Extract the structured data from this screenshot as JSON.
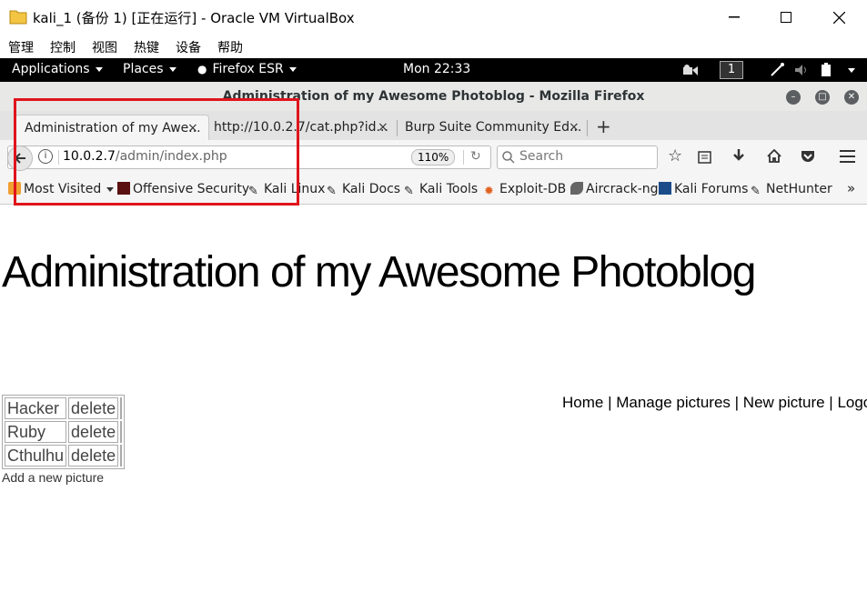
{
  "vbox": {
    "title": "kali_1 (备份 1) [正在运行] - Oracle VM VirtualBox",
    "menu": [
      "管理",
      "控制",
      "视图",
      "热键",
      "设备",
      "帮助"
    ]
  },
  "gnome": {
    "applications": "Applications",
    "places": "Places",
    "firefox": "Firefox ESR",
    "clock": "Mon 22:33",
    "workspace": "1"
  },
  "firefox": {
    "window_title": "Administration of my Awesome Photoblog - Mozilla Firefox",
    "tabs": [
      {
        "label": "Administration of my Awe..."
      },
      {
        "label": "http://10.0.2.7/cat.php?id..."
      },
      {
        "label": "Burp Suite Community Ed..."
      }
    ],
    "url_host": "10.0.2.7",
    "url_path": "/admin/index.php",
    "zoom": "110%",
    "search_placeholder": "Search",
    "bookmarks": [
      "Most Visited",
      "Offensive Security",
      "Kali Linux",
      "Kali Docs",
      "Kali Tools",
      "Exploit-DB",
      "Aircrack-ng",
      "Kali Forums",
      "NetHunter"
    ]
  },
  "page": {
    "heading": "Administration of my Awesome Photoblog",
    "nav": [
      "Home",
      "Manage pictures",
      "New picture",
      "Logo"
    ],
    "rows": [
      {
        "title": "Hacker",
        "action": "delete"
      },
      {
        "title": "Ruby",
        "action": "delete"
      },
      {
        "title": "Cthulhu",
        "action": "delete"
      }
    ],
    "add_link": "Add a new picture"
  },
  "colors": {
    "highlight": "#e0141b",
    "gnome_bar": "#000000"
  }
}
